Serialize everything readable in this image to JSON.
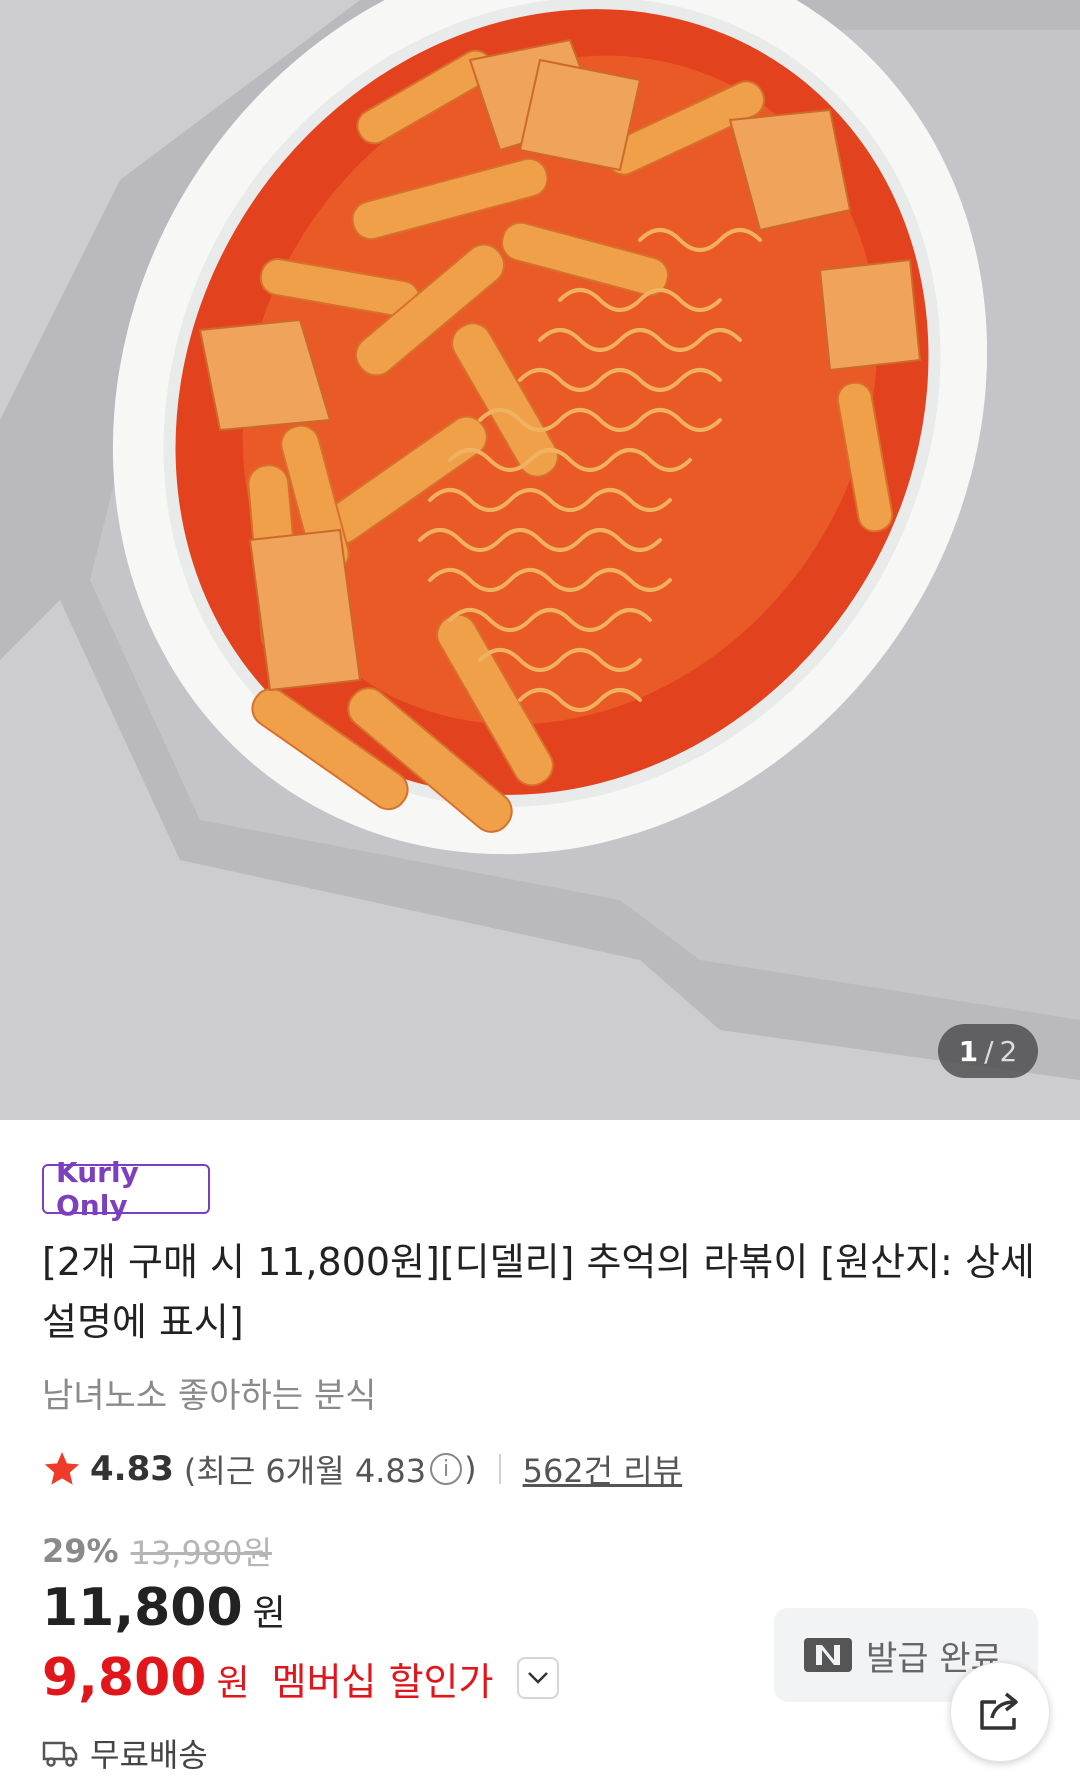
{
  "gallery": {
    "current": "1",
    "separator": "/",
    "total": "2"
  },
  "badge": "Kurly Only",
  "product": {
    "title": "[2개 구매 시 11,800원][디델리] 추억의 라볶이 [원산지: 상세설명에 표시]",
    "subtitle": "남녀노소 좋아하는 분식"
  },
  "rating": {
    "score": "4.83",
    "recent": "(최근 6개월 4.83",
    "recent_close": ")",
    "reviews_link": "562건 리뷰"
  },
  "pricing": {
    "discount_rate": "29%",
    "original_price": "13,980원",
    "price": "11,800",
    "currency": "원",
    "member_price": "9,800",
    "member_currency": "원",
    "member_label": "멤버십 할인가"
  },
  "coupon": {
    "label": "발급 완료"
  },
  "delivery": {
    "label": "무료배송"
  },
  "colors": {
    "accent_purple": "#7b3fbf",
    "sale_red": "#e0161b",
    "star": "#f03a2a"
  }
}
